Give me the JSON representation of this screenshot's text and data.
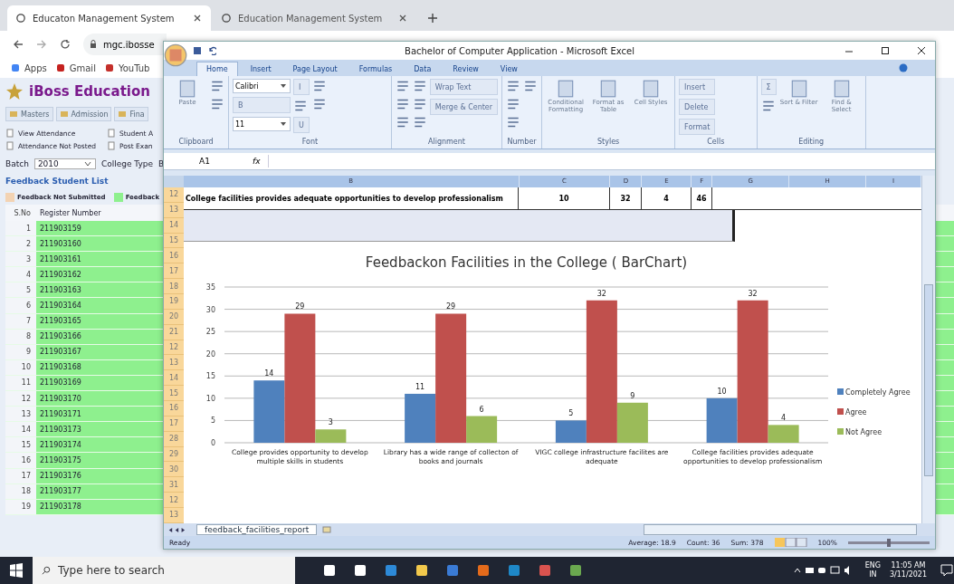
{
  "browser": {
    "tabs": [
      {
        "title": "Educaton Management System",
        "selected": true
      },
      {
        "title": "Education Management System",
        "selected": false
      }
    ],
    "address": "mgc.ibosse",
    "bookmarks": [
      "Apps",
      "Gmail",
      "YouTub"
    ]
  },
  "page": {
    "brand": "iBoss Education",
    "menu": [
      "Masters",
      "Admission",
      "Fina"
    ],
    "actions": [
      "View Attendance",
      "Student A",
      "Attendance Not Posted",
      "Post Exan"
    ],
    "filter": {
      "batch_label": "Batch",
      "batch_value": "2010",
      "type_label": "College Type",
      "type_value": "B"
    },
    "section_title": "Feedback Student List",
    "legend": [
      {
        "label": "Feedback Not Submitted",
        "color": "#f3d3b3"
      },
      {
        "label": "Feedback",
        "color": "#8ef08e"
      }
    ],
    "columns": [
      "S.No",
      "Register Number"
    ],
    "rows": [
      {
        "sno": "1",
        "reg": "211903159"
      },
      {
        "sno": "2",
        "reg": "211903160"
      },
      {
        "sno": "3",
        "reg": "211903161"
      },
      {
        "sno": "4",
        "reg": "211903162"
      },
      {
        "sno": "5",
        "reg": "211903163"
      },
      {
        "sno": "6",
        "reg": "211903164"
      },
      {
        "sno": "7",
        "reg": "211903165"
      },
      {
        "sno": "8",
        "reg": "211903166"
      },
      {
        "sno": "9",
        "reg": "211903167"
      },
      {
        "sno": "10",
        "reg": "211903168"
      },
      {
        "sno": "11",
        "reg": "211903169"
      },
      {
        "sno": "12",
        "reg": "211903170"
      },
      {
        "sno": "13",
        "reg": "211903171"
      },
      {
        "sno": "14",
        "reg": "211903173"
      },
      {
        "sno": "15",
        "reg": "211903174"
      },
      {
        "sno": "16",
        "reg": "211903175"
      },
      {
        "sno": "17",
        "reg": "211903176"
      },
      {
        "sno": "18",
        "reg": "211903177"
      },
      {
        "sno": "19",
        "reg": "211903178"
      }
    ]
  },
  "excel": {
    "title": "Bachelor of Computer Application  -  Microsoft Excel",
    "ribbon_tabs": [
      {
        "label": "Home",
        "selected": true
      },
      {
        "label": "Insert",
        "selected": false
      },
      {
        "label": "Page Layout",
        "selected": false
      },
      {
        "label": "Formulas",
        "selected": false
      },
      {
        "label": "Data",
        "selected": false
      },
      {
        "label": "Review",
        "selected": false
      },
      {
        "label": "View",
        "selected": false
      }
    ],
    "groups": [
      {
        "name": "Clipboard",
        "tools": [
          {
            "kind": "large",
            "label": "Paste"
          },
          {
            "kind": "icon"
          },
          {
            "kind": "icon"
          }
        ]
      },
      {
        "name": "Font",
        "tools": [
          {
            "kind": "field",
            "label": "Calibri"
          },
          {
            "kind": "button",
            "label": "B"
          },
          {
            "kind": "field",
            "label": "11"
          },
          {
            "kind": "button",
            "label": "I"
          },
          {
            "kind": "icon"
          },
          {
            "kind": "button",
            "label": "U"
          },
          {
            "kind": "icon"
          },
          {
            "kind": "icon"
          }
        ]
      },
      {
        "name": "Alignment",
        "tools": [
          {
            "kind": "icon"
          },
          {
            "kind": "icon"
          },
          {
            "kind": "icon"
          },
          {
            "kind": "icon"
          },
          {
            "kind": "icon"
          },
          {
            "kind": "icon"
          },
          {
            "kind": "button",
            "label": "Wrap Text"
          },
          {
            "kind": "button",
            "label": "Merge & Center"
          }
        ]
      },
      {
        "name": "Number",
        "tools": [
          {
            "kind": "icon"
          },
          {
            "kind": "icon"
          },
          {
            "kind": "icon"
          },
          {
            "kind": "icon"
          }
        ]
      },
      {
        "name": "Styles",
        "tools": [
          {
            "kind": "large",
            "label": "Conditional Formatting"
          },
          {
            "kind": "large",
            "label": "Format as Table"
          },
          {
            "kind": "large",
            "label": "Cell Styles"
          }
        ]
      },
      {
        "name": "Cells",
        "tools": [
          {
            "kind": "button",
            "label": "Insert"
          },
          {
            "kind": "button",
            "label": "Delete"
          },
          {
            "kind": "button",
            "label": "Format"
          }
        ]
      },
      {
        "name": "Editing",
        "tools": [
          {
            "kind": "button",
            "label": "Σ"
          },
          {
            "kind": "icon"
          },
          {
            "kind": "large",
            "label": "Sort & Filter"
          },
          {
            "kind": "large",
            "label": "Find & Select"
          }
        ]
      }
    ],
    "name_box": "A1",
    "fx": "fx",
    "col_headers": [
      "B",
      "C",
      "D",
      "E",
      "F",
      "G",
      "H",
      "I"
    ],
    "row_numbers": [
      "12",
      "13",
      "14",
      "15",
      "16",
      "17",
      "18",
      "19",
      "20",
      "21",
      "12",
      "13",
      "14",
      "15",
      "16",
      "17",
      "28",
      "29",
      "30",
      "31",
      "12",
      "13"
    ],
    "row_12": [
      "College facilities provides adequate opportunities to develop professionalism",
      "10",
      "32",
      "4",
      "46"
    ],
    "chart_data": {
      "type": "bar",
      "title": "Feedbackon Facilities in the College ( BarChart)",
      "categories": [
        "College provides opportunity to develop multiple skills in students",
        "Library has a wide range of collecton of books and journals",
        "VIGC college infrastructure facilites are adequate",
        "College facilities provides adequate opportunities to develop professionalism"
      ],
      "series": [
        {
          "name": "Completely Agree",
          "color": "#4f81bd",
          "values": [
            14,
            11,
            5,
            10
          ]
        },
        {
          "name": "Agree",
          "color": "#c0504d",
          "values": [
            29,
            29,
            32,
            32
          ]
        },
        {
          "name": "Not Agree",
          "color": "#9bbb59",
          "values": [
            3,
            6,
            9,
            4
          ]
        }
      ],
      "ylim": [
        0,
        35
      ],
      "yticks": [
        0,
        5,
        10,
        15,
        20,
        25,
        30,
        35
      ],
      "data_labels": true,
      "grid": true,
      "legend": true
    },
    "sheet_tab": "feedback_facilities_report",
    "status": {
      "ready": "Ready",
      "average": "Average: 18.9",
      "count": "Count: 36",
      "sum": "Sum: 378",
      "zoom": "100%",
      "zoom_slider": {
        "level": 0.5
      }
    }
  },
  "taskbar": {
    "search_placeholder": "Type here to search",
    "lang": "ENG",
    "region": "IN",
    "time": "11:05 AM",
    "date": "3/11/2021"
  }
}
